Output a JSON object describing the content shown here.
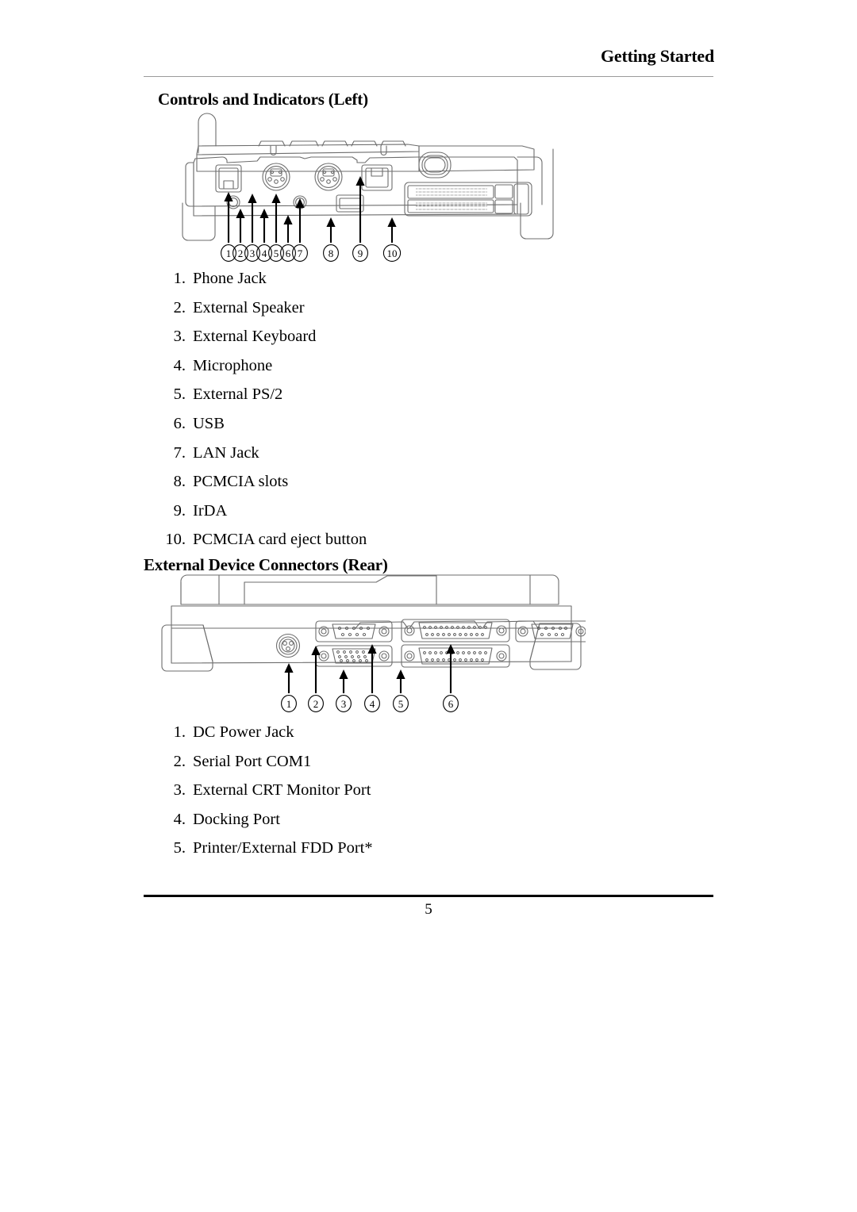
{
  "header": {
    "title": "Getting Started"
  },
  "sections": [
    {
      "heading": "Controls and Indicators (Left)",
      "figure_name": "left-side-port-diagram",
      "callout_numbers": [
        "1",
        "2",
        "3",
        "4",
        "5",
        "6",
        "7",
        "8",
        "9",
        "10"
      ],
      "items": [
        {
          "marker": "1.",
          "text": "Phone Jack"
        },
        {
          "marker": "2.",
          "text": "External Speaker"
        },
        {
          "marker": "3.",
          "text": "External Keyboard"
        },
        {
          "marker": "4.",
          "text": "Microphone"
        },
        {
          "marker": "5.",
          "text": "External PS/2"
        },
        {
          "marker": "6.",
          "text": "USB"
        },
        {
          "marker": "7.",
          "text": "LAN Jack"
        },
        {
          "marker": "8.",
          "text": "PCMCIA slots"
        },
        {
          "marker": "9.",
          "text": "IrDA"
        },
        {
          "marker": "10.",
          "text": "PCMCIA card eject button"
        }
      ]
    },
    {
      "heading": "External Device Connectors (Rear)",
      "figure_name": "rear-connector-diagram",
      "callout_numbers": [
        "1",
        "2",
        "3",
        "4",
        "5",
        "6"
      ],
      "items": [
        {
          "marker": "1.",
          "text": "DC Power Jack"
        },
        {
          "marker": "2.",
          "text": "Serial Port COM1"
        },
        {
          "marker": "3.",
          "text": "External CRT Monitor Port"
        },
        {
          "marker": "4.",
          "text": "Docking Port"
        },
        {
          "marker": "5.",
          "text": "Printer/External FDD Port*"
        }
      ]
    }
  ],
  "footer": {
    "page_number": "5"
  },
  "colors": {
    "text": "#000000",
    "header_rule": "#9a9a9a",
    "footer_rule": "#000000",
    "line_art": "#6d6d6d",
    "line_art_dark": "#000000",
    "page_background": "#ffffff"
  }
}
